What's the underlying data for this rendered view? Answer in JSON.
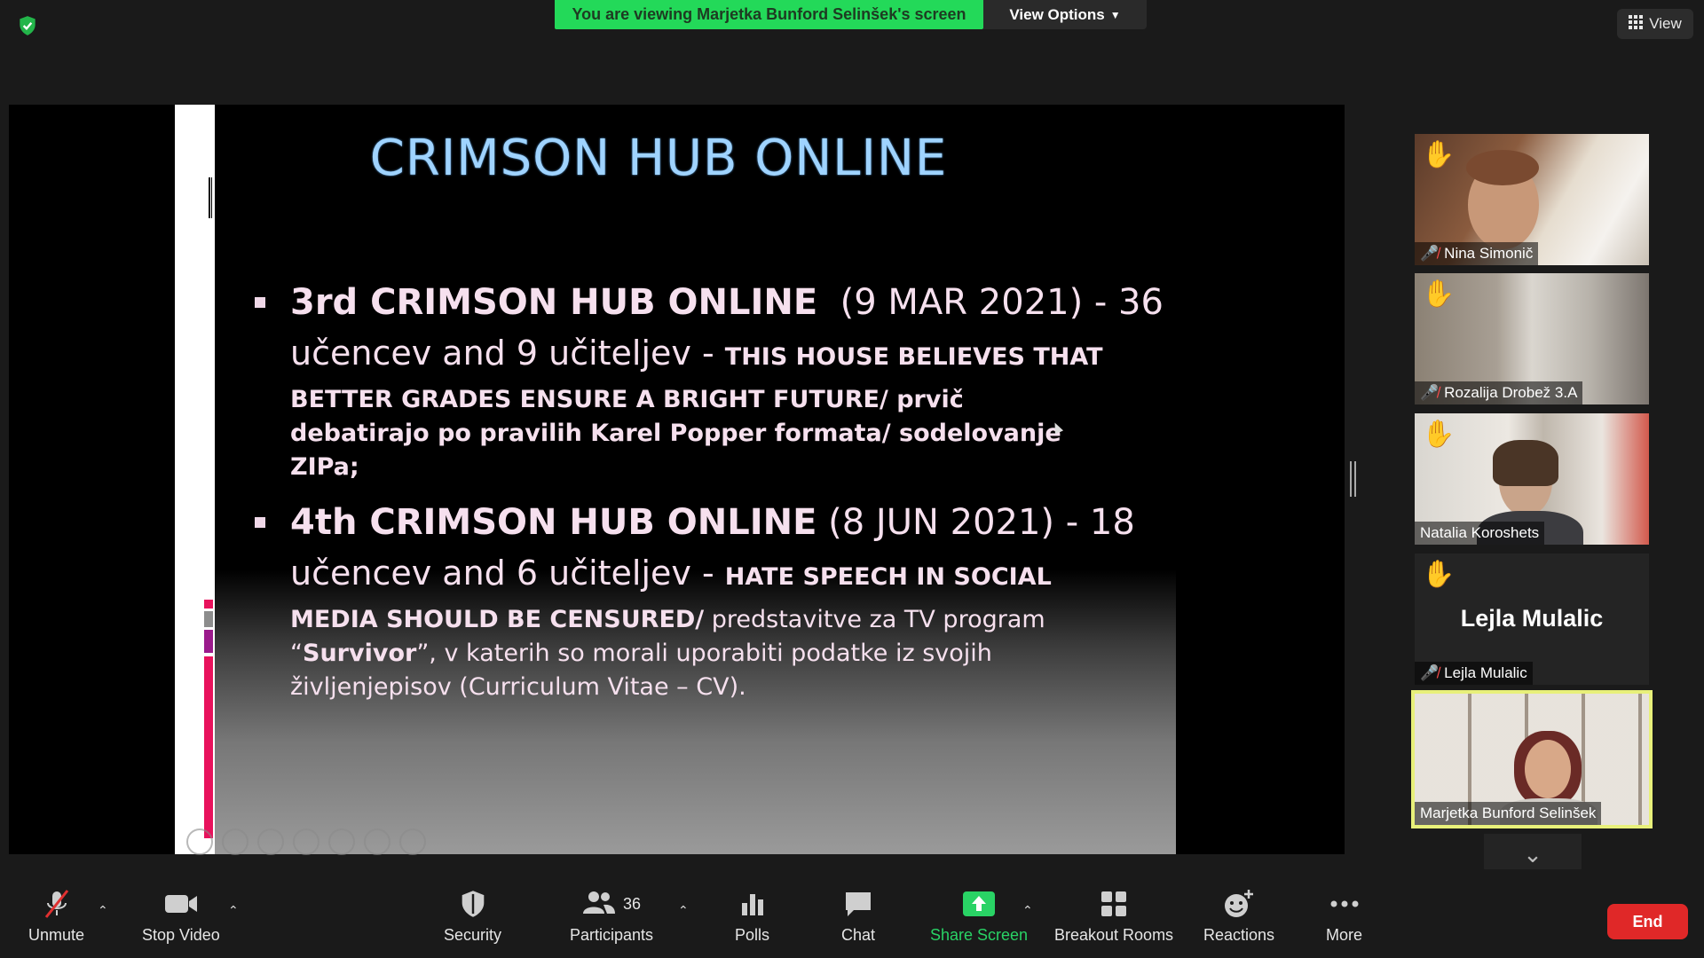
{
  "banner": {
    "text": "You are viewing Marjetka Bunford Selinšek's screen",
    "color": "#23d959"
  },
  "view_options": {
    "label": "View Options"
  },
  "view_button": {
    "label": "View"
  },
  "slide": {
    "title": "CRIMSON HUB ONLINE",
    "bullet1": {
      "bold_head": "3rd CRIMSON HUB ONLINE",
      "date": "(9 MAR 2021) -  36",
      "line2_text": "učencev and 9 učiteljev - ",
      "line2_caps": "THIS HOUSE BELIEVES THAT",
      "body": "BETTER GRADES ENSURE A BRIGHT FUTURE/ prvič debatirajo po pravilih Karel Popper formata/ sodelovanje ZIPa;"
    },
    "bullet2": {
      "bold_head": "4th CRIMSON HUB ONLINE",
      "date": "(8 JUN 2021) - 18",
      "line2_text": "učencev and 6 učiteljev - ",
      "line2_caps": "HATE SPEECH IN SOCIAL",
      "body_caps": "MEDIA SHOULD BE CENSURED/",
      "body_1": " predstavitve za TV program",
      "body_quote_open": "“",
      "body_bold": "Survivor",
      "body_2": "”, v katerih so morali uporabiti podatke iz svojih življenjepisov (Curriculum Vitae – CV)."
    }
  },
  "participants": [
    {
      "name": "Nina Simonič",
      "muted": true,
      "hand_raised": true
    },
    {
      "name": "Rozalija Drobež 3.A",
      "muted": true,
      "hand_raised": true
    },
    {
      "name": "Natalia Koroshets",
      "muted": false,
      "hand_raised": true
    },
    {
      "name": "Lejla Mulalic",
      "display_name": "Lejla Mulalic",
      "muted": true,
      "hand_raised": true,
      "video": false
    },
    {
      "name": "Marjetka Bunford Selinšek",
      "muted": false,
      "hand_raised": false,
      "active_speaker": true
    }
  ],
  "toolbar": {
    "unmute": "Unmute",
    "stop_video": "Stop Video",
    "security": "Security",
    "participants": "Participants",
    "participants_count": "36",
    "polls": "Polls",
    "chat": "Chat",
    "share_screen": "Share Screen",
    "breakout_rooms": "Breakout Rooms",
    "reactions": "Reactions",
    "more": "More",
    "end": "End"
  },
  "colors": {
    "accent_green": "#29d365",
    "end_red": "#e02828",
    "speaker_border": "#e8f07a",
    "title_blue": "#9fd3ff"
  }
}
